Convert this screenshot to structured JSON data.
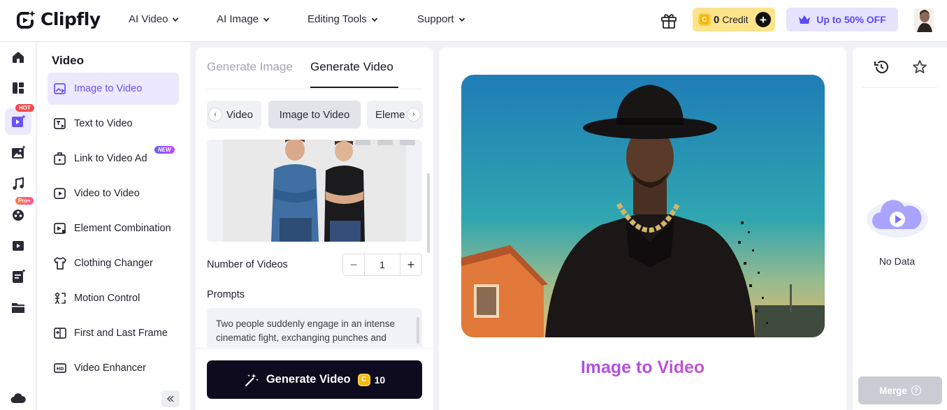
{
  "brand": {
    "name": "Clipfly"
  },
  "nav": [
    {
      "label": "AI Video"
    },
    {
      "label": "AI Image"
    },
    {
      "label": "Editing Tools"
    },
    {
      "label": "Support"
    }
  ],
  "header": {
    "credit_count": "0",
    "credit_unit": "Credit",
    "credit_coin": "C",
    "promo_label": "Up to 50% OFF"
  },
  "rail": {
    "hot_badge": "HOT",
    "pro_badge": "Pro+"
  },
  "menu": {
    "title": "Video",
    "new_badge": "NEW",
    "items": [
      {
        "label": "Image to Video",
        "icon": "image-to-video-icon"
      },
      {
        "label": "Text to Video",
        "icon": "text-to-video-icon"
      },
      {
        "label": "Link to Video Ad",
        "icon": "link-to-video-icon"
      },
      {
        "label": "Video to Video",
        "icon": "video-to-video-icon"
      },
      {
        "label": "Element Combination",
        "icon": "element-combination-icon"
      },
      {
        "label": "Clothing Changer",
        "icon": "clothing-changer-icon"
      },
      {
        "label": "Motion Control",
        "icon": "motion-control-icon"
      },
      {
        "label": "First and Last Frame",
        "icon": "first-last-frame-icon"
      },
      {
        "label": "Video Enhancer",
        "icon": "video-enhancer-icon"
      }
    ]
  },
  "generator": {
    "tabs": [
      "Generate Image",
      "Generate Video"
    ],
    "active_tab": "Generate Video",
    "modes": [
      "Video",
      "Image to Video",
      "Eleme"
    ],
    "selected_mode": "Image to Video",
    "num_videos_label": "Number of Videos",
    "num_videos_value": "1",
    "prompts_label": "Prompts",
    "prompt_text": "Two people suddenly engage in an intense cinematic fight, exchanging punches and dodges with dramatic",
    "generate_label": "Generate Video",
    "generate_cost": "10"
  },
  "main": {
    "title": "Image to Video"
  },
  "side": {
    "empty_text": "No Data",
    "merge_label": "Merge",
    "merge_help": "?"
  },
  "colors": {
    "accent": "#6a52f5",
    "dark": "#0d0b1d",
    "credit_bg": "#fde38a",
    "promo_bg": "#e6e3ff"
  }
}
